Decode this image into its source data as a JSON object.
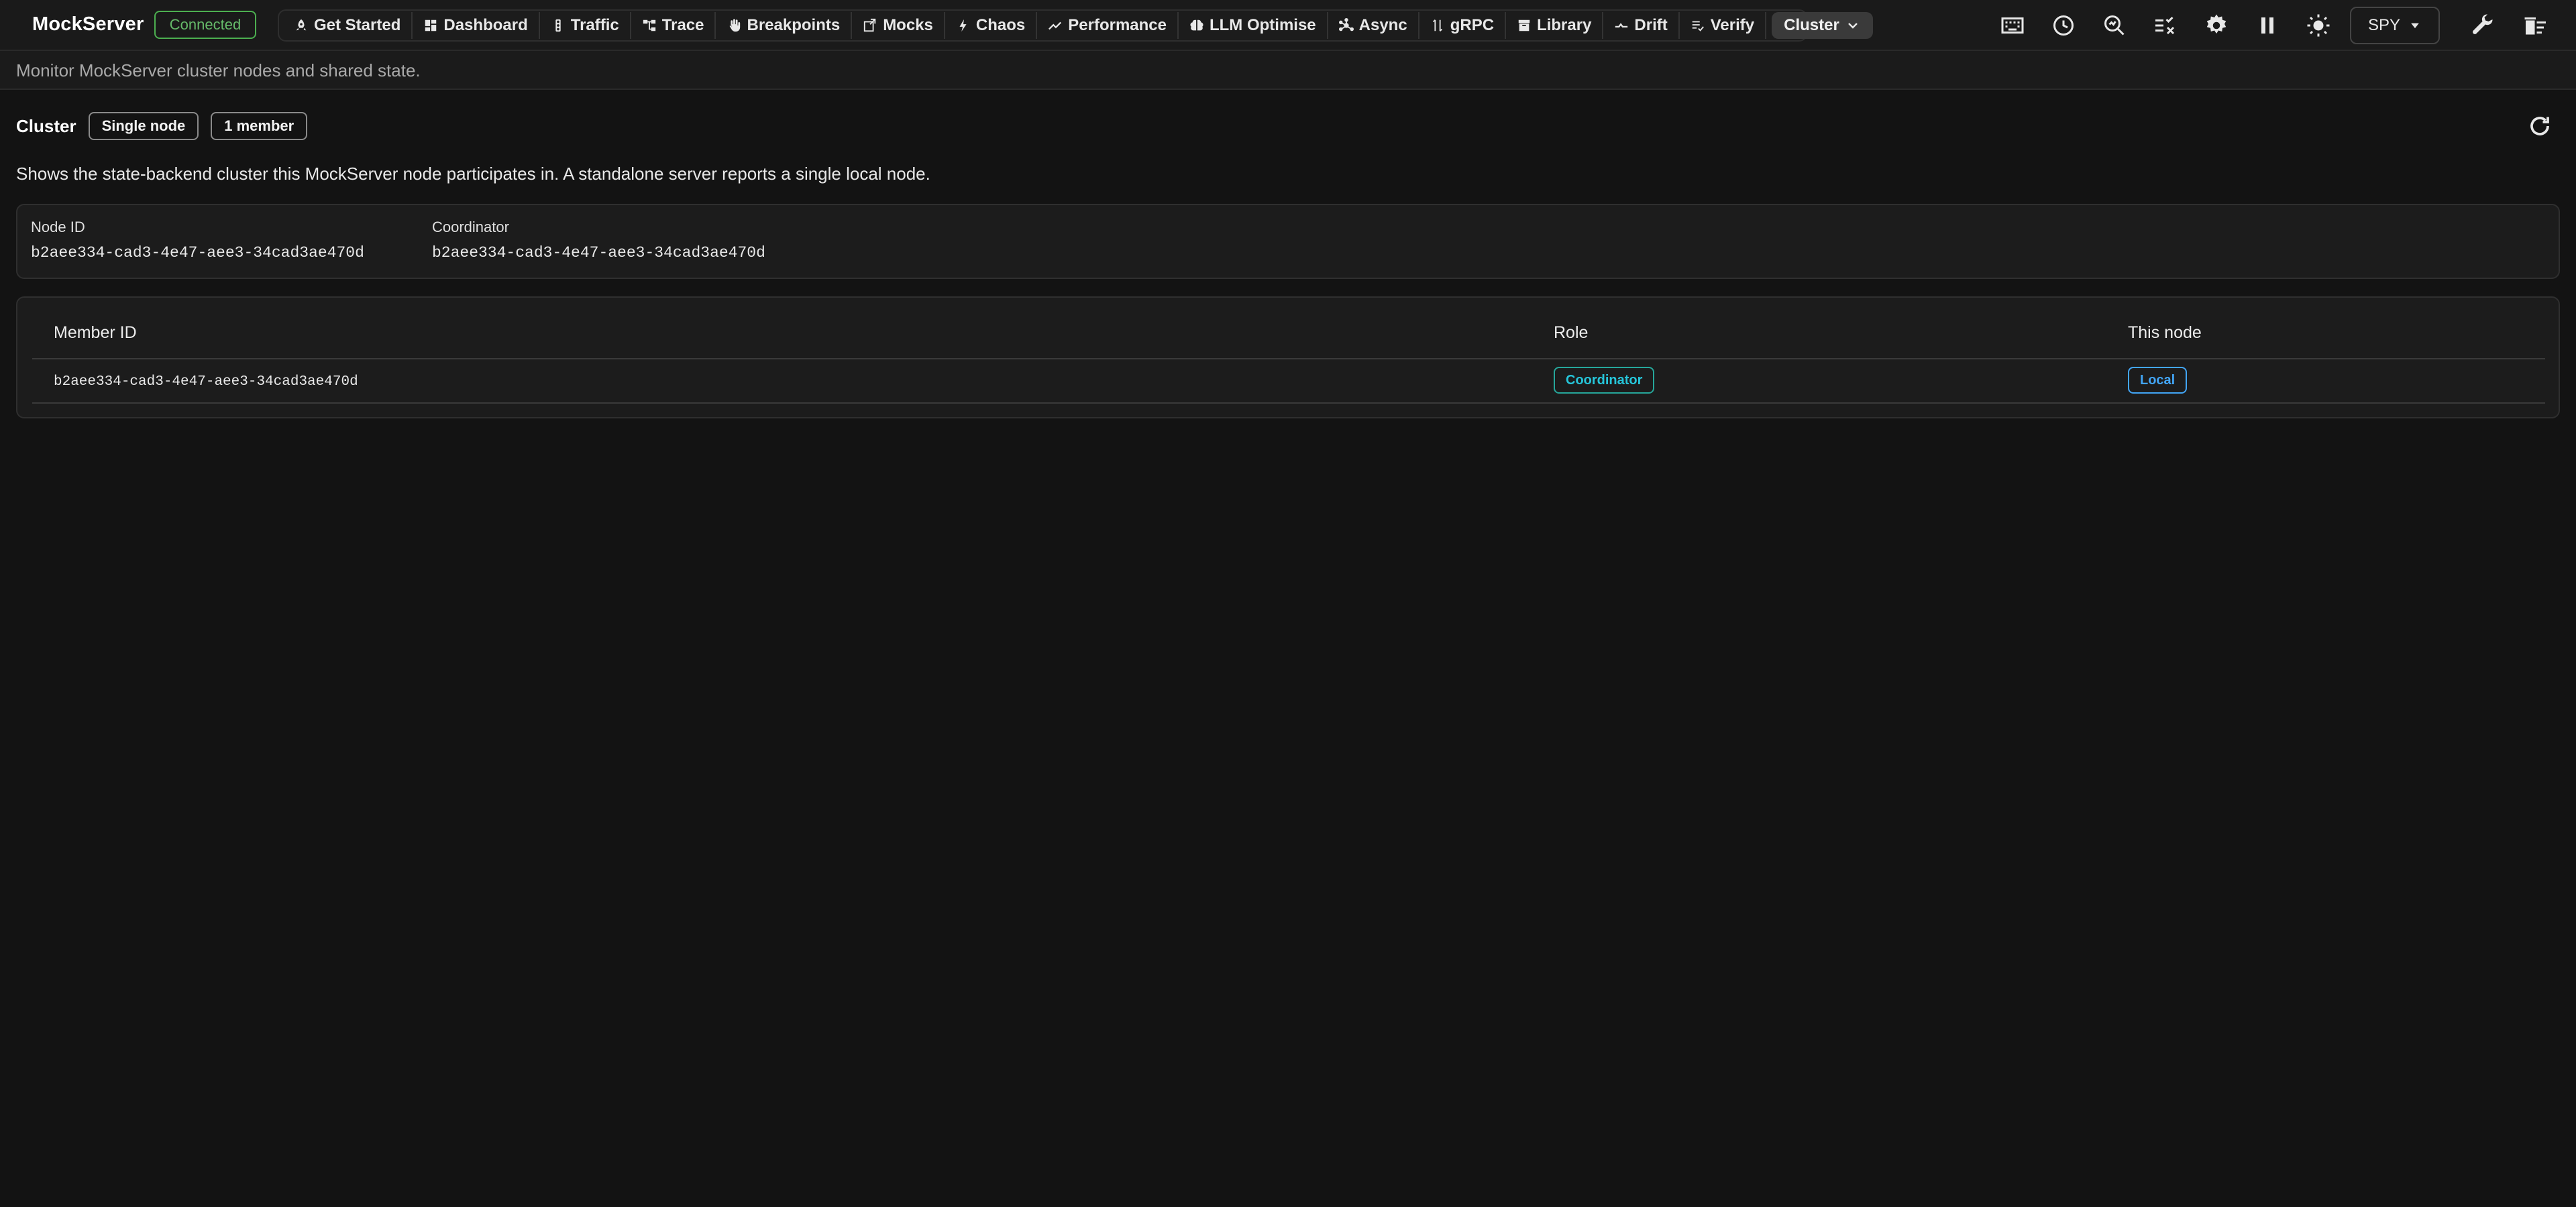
{
  "app": {
    "title": "MockServer",
    "connection_status": "Connected",
    "status_color": "#4caf50"
  },
  "nav": {
    "items": [
      {
        "label": "Get Started",
        "icon": "rocket-icon"
      },
      {
        "label": "Dashboard",
        "icon": "dashboard-icon"
      },
      {
        "label": "Traffic",
        "icon": "traffic-icon"
      },
      {
        "label": "Trace",
        "icon": "trace-icon"
      },
      {
        "label": "Breakpoints",
        "icon": "hand-icon"
      },
      {
        "label": "Mocks",
        "icon": "mock-icon"
      },
      {
        "label": "Chaos",
        "icon": "lightning-icon"
      },
      {
        "label": "Performance",
        "icon": "trending-icon"
      },
      {
        "label": "LLM Optimise",
        "icon": "brain-icon"
      },
      {
        "label": "Async",
        "icon": "hub-icon"
      },
      {
        "label": "gRPC",
        "icon": "grpc-icon"
      },
      {
        "label": "Library",
        "icon": "archive-icon"
      },
      {
        "label": "Drift",
        "icon": "drift-icon"
      },
      {
        "label": "Verify",
        "icon": "checklist-icon"
      }
    ],
    "active": {
      "label": "Cluster",
      "icon": "chevron-down-icon"
    }
  },
  "toolbar": {
    "icons": [
      "keyboard-icon",
      "history-icon",
      "search-analytics-icon",
      "rule-icon",
      "settings-icon",
      "pause-icon",
      "theme-icon",
      "wrench-icon",
      "clear-icon"
    ],
    "mode": "SPY"
  },
  "subtitle": "Monitor MockServer cluster nodes and shared state.",
  "cluster": {
    "title": "Cluster",
    "chips": [
      "Single node",
      "1 member"
    ],
    "description": "Shows the state-backend cluster this MockServer node participates in. A standalone server reports a single local node.",
    "node_id_label": "Node ID",
    "node_id": "b2aee334-cad3-4e47-aee3-34cad3ae470d",
    "coordinator_label": "Coordinator",
    "coordinator": "b2aee334-cad3-4e47-aee3-34cad3ae470d"
  },
  "members_table": {
    "headers": [
      "Member ID",
      "Role",
      "This node"
    ],
    "rows": [
      {
        "member_id": "b2aee334-cad3-4e47-aee3-34cad3ae470d",
        "role": "Coordinator",
        "this_node": "Local"
      }
    ]
  },
  "colors": {
    "accent_teal": "#26a69a",
    "accent_blue": "#42a5f5"
  }
}
